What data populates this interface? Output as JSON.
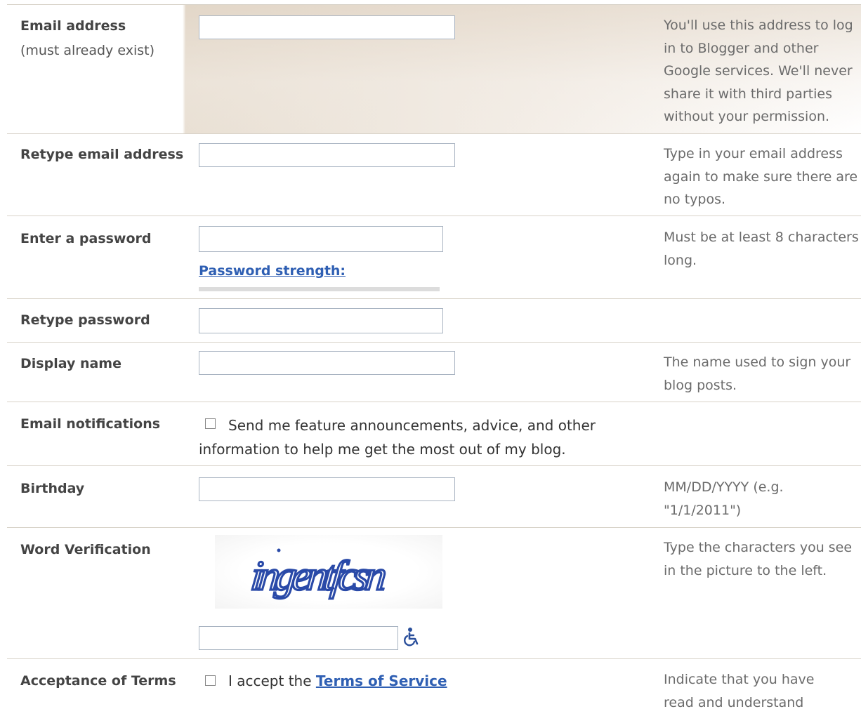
{
  "rows": {
    "email": {
      "label": "Email address",
      "sublabel": "(must already exist)",
      "value": "",
      "help": "You'll use this address to log in to Blogger and other Google services. We'll never share it with third parties without your permission."
    },
    "retype_email": {
      "label": "Retype email address",
      "value": "",
      "help": "Type in your email address again to make sure there are no typos."
    },
    "password": {
      "label": "Enter a password",
      "value": "",
      "strength_label": "Password strength:",
      "strength_level": 0,
      "help": "Must be at least 8 characters long."
    },
    "retype_password": {
      "label": "Retype password",
      "value": ""
    },
    "display_name": {
      "label": "Display name",
      "value": "",
      "help": "The name used to sign your blog posts."
    },
    "notifications": {
      "label": "Email notifications",
      "checked": false,
      "text": "Send me feature announcements, advice, and other information to help me get the most out of my blog."
    },
    "birthday": {
      "label": "Birthday",
      "value": "",
      "help": "MM/DD/YYYY (e.g. \"1/1/2011\")"
    },
    "verification": {
      "label": "Word Verification",
      "captcha_text": "ingentfcsn",
      "value": "",
      "help": "Type the characters you see in the picture to the left."
    },
    "terms": {
      "label": "Acceptance of Terms",
      "checked": false,
      "text_prefix": "I accept the",
      "link_text": "Terms of Service",
      "help": "Indicate that you have read and understand"
    }
  },
  "icons": {
    "accessibility": "wheelchair-icon"
  },
  "colors": {
    "link": "#2f5fb3",
    "captcha_ink": "#2a4aa8",
    "divider": "#d8d2c8",
    "highlight": "#e9e0d4"
  }
}
